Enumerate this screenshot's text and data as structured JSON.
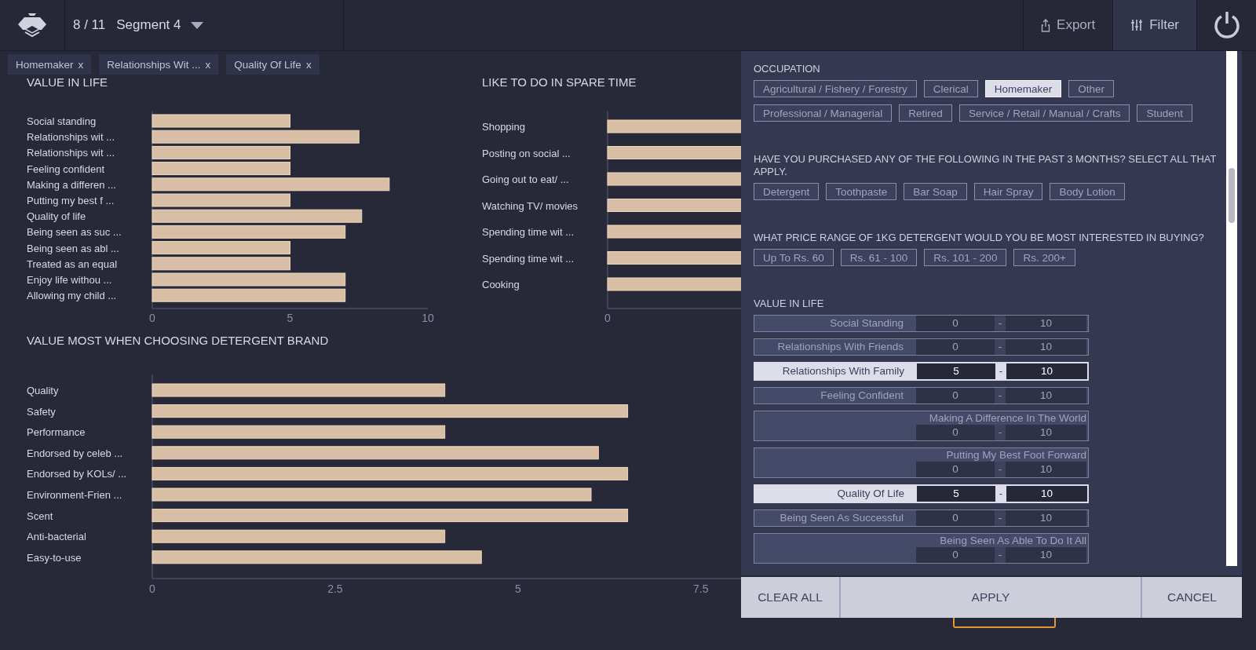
{
  "header": {
    "position": "8 / 11",
    "segment": "Segment 4",
    "actions": [
      {
        "kind": "export",
        "label": "Export",
        "selected": false
      },
      {
        "kind": "filter",
        "label": "Filter",
        "selected": true
      }
    ]
  },
  "chips": [
    {
      "label": "Homemaker",
      "close": "x"
    },
    {
      "label": "Relationships Wit ...",
      "close": "x"
    },
    {
      "label": "Quality Of Life",
      "close": "x"
    }
  ],
  "value_chart": {
    "title": "VALUE IN LIFE",
    "chart_data": {
      "type": "bar",
      "orientation": "horizontal",
      "categories": [
        "Social standing",
        "Relationships wit ...",
        "Relationships wit ...",
        "Feeling confident",
        "Making a differen ...",
        "Putting my best f ...",
        "Quality of life",
        "Being seen as suc ...",
        "Being seen as abl ...",
        "Treated as an equal",
        "Enjoy life withou ...",
        "Allowing my child ..."
      ],
      "values": [
        5,
        7.5,
        5,
        5,
        8.6,
        5,
        7.6,
        7,
        5,
        5,
        7,
        7
      ],
      "xlim": [
        0,
        10
      ],
      "xticks": [
        0,
        5,
        10
      ]
    }
  },
  "spare_time_chart": {
    "title": "LIKE TO DO IN SPARE TIME",
    "labels": [
      "Shopping",
      "Posting on social ...",
      "Going out to eat/ ...",
      "Watching TV/ movies",
      "Spending time wit ...",
      "Spending time wit ...",
      "Cooking"
    ],
    "axis_tick": "0"
  },
  "detergent_chart": {
    "title": "VALUE MOST WHEN CHOOSING DETERGENT BRAND",
    "chart_data": {
      "type": "bar",
      "orientation": "horizontal",
      "categories": [
        "Quality",
        "Safety",
        "Performance",
        "Endorsed by celeb ...",
        "Endorsed by KOLs/ ...",
        "Environment-Frien ...",
        "Scent",
        "Anti-bacterial",
        "Easy-to-use"
      ],
      "values": [
        4,
        6.5,
        4,
        6.1,
        6.5,
        6,
        6.5,
        4,
        4.5
      ],
      "xlim": [
        0,
        8.05
      ],
      "xticks": [
        0,
        2.5,
        5,
        7.5
      ]
    }
  },
  "filter_panel": {
    "sections": [
      {
        "kind": "options",
        "title": "OCCUPATION",
        "options": [
          {
            "label": "Agricultural / Fishery / Forestry",
            "selected": false
          },
          {
            "label": "Clerical",
            "selected": false
          },
          {
            "label": "Homemaker",
            "selected": true
          },
          {
            "label": "Other",
            "selected": false
          },
          {
            "label": "Professional / Managerial",
            "selected": false
          },
          {
            "label": "Retired",
            "selected": false
          },
          {
            "label": "Service / Retail / Manual / Crafts",
            "selected": false
          },
          {
            "label": "Student",
            "selected": false
          }
        ]
      },
      {
        "kind": "options",
        "title": "HAVE YOU PURCHASED ANY OF THE FOLLOWING IN THE PAST 3 MONTHS? SELECT ALL THAT APPLY.",
        "options": [
          {
            "label": "Detergent",
            "selected": false
          },
          {
            "label": "Toothpaste",
            "selected": false
          },
          {
            "label": "Bar Soap",
            "selected": false
          },
          {
            "label": "Hair Spray",
            "selected": false
          },
          {
            "label": "Body Lotion",
            "selected": false
          }
        ]
      },
      {
        "kind": "options",
        "title": "WHAT PRICE RANGE OF 1KG DETERGENT WOULD YOU BE MOST INTERESTED IN BUYING?",
        "options": [
          {
            "label": "Up To Rs. 60",
            "selected": false
          },
          {
            "label": "Rs. 61 - 100",
            "selected": false
          },
          {
            "label": "Rs. 101 - 200",
            "selected": false
          },
          {
            "label": "Rs. 200+",
            "selected": false
          }
        ]
      },
      {
        "kind": "ranges",
        "title": "VALUE IN LIFE",
        "rows": [
          {
            "label": "Social Standing",
            "min": "0",
            "sep": "-",
            "max": "10",
            "selected": false
          },
          {
            "label": "Relationships With Friends",
            "min": "0",
            "sep": "-",
            "max": "10",
            "selected": false
          },
          {
            "label": "Relationships With Family",
            "min": "5",
            "sep": "-",
            "max": "10",
            "selected": true
          },
          {
            "label": "Feeling Confident",
            "min": "0",
            "sep": "-",
            "max": "10",
            "selected": false
          },
          {
            "label": "Making A Difference In The World",
            "min": "0",
            "sep": "-",
            "max": "10",
            "selected": false
          },
          {
            "label": "Putting My Best Foot Forward",
            "min": "0",
            "sep": "-",
            "max": "10",
            "selected": false
          },
          {
            "label": "Quality Of Life",
            "min": "5",
            "sep": "-",
            "max": "10",
            "selected": true
          },
          {
            "label": "Being Seen As Successful",
            "min": "0",
            "sep": "-",
            "max": "10",
            "selected": false
          },
          {
            "label": "Being Seen As Able To Do It All",
            "min": "0",
            "sep": "-",
            "max": "10",
            "selected": false
          }
        ]
      }
    ],
    "buttons": [
      {
        "kind": "clear",
        "label": "CLEAR ALL"
      },
      {
        "kind": "apply",
        "label": "APPLY"
      },
      {
        "kind": "cancel",
        "label": "CANCEL"
      }
    ]
  }
}
